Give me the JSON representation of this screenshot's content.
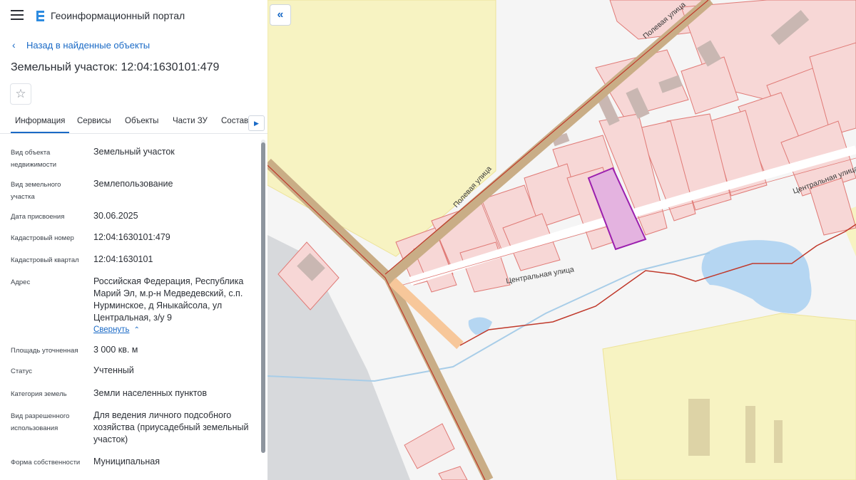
{
  "app": {
    "title": "Геоинформационный портал",
    "icons": {
      "menu": "hamburger-menu-icon",
      "logo": "portal-logo-icon"
    }
  },
  "nav": {
    "back_label": "Назад в найденные объекты"
  },
  "object": {
    "title": "Земельный участок: 12:04:1630101:479",
    "favorite_icon": "star-icon"
  },
  "tabs": {
    "items": [
      "Информация",
      "Сервисы",
      "Объекты",
      "Части ЗУ",
      "Состав"
    ],
    "active": "Информация"
  },
  "details": [
    {
      "label": "Вид объекта недвижимости",
      "value": "Земельный участок"
    },
    {
      "label": "Вид земельного участка",
      "value": "Землепользование"
    },
    {
      "label": "Дата присвоения",
      "value": "30.06.2025"
    },
    {
      "label": "Кадастровый номер",
      "value": "12:04:1630101:479"
    },
    {
      "label": "Кадастровый квартал",
      "value": "12:04:1630101"
    },
    {
      "label": "Адрес",
      "value": "Российская Федерация, Республика Марий Эл, м.р-н Медведевский, с.п. Нурминское, д Яныкайсола, ул Центральная, з/у 9"
    },
    {
      "label": "Площадь уточненная",
      "value": "3 000 кв. м"
    },
    {
      "label": "Статус",
      "value": "Учтенный"
    },
    {
      "label": "Категория земель",
      "value": "Земли населенных пунктов"
    },
    {
      "label": "Вид разрешенного использования",
      "value": "Для ведения личного подсобного хозяйства (приусадебный земельный участок)"
    },
    {
      "label": "Форма собственности",
      "value": "Муниципальная"
    }
  ],
  "address_collapse_label": "Свернуть",
  "map": {
    "streets": [
      "Полевая улица",
      "Центральная улица",
      "Центральная улица"
    ],
    "colors": {
      "parcel_fill": "#f7d7d6",
      "parcel_stroke": "#e07a76",
      "selected_parcel": "#b03fb8",
      "zone_yellow": "#f7f3c2",
      "road": "#c9ad86",
      "water": "#b5d6f2"
    }
  }
}
